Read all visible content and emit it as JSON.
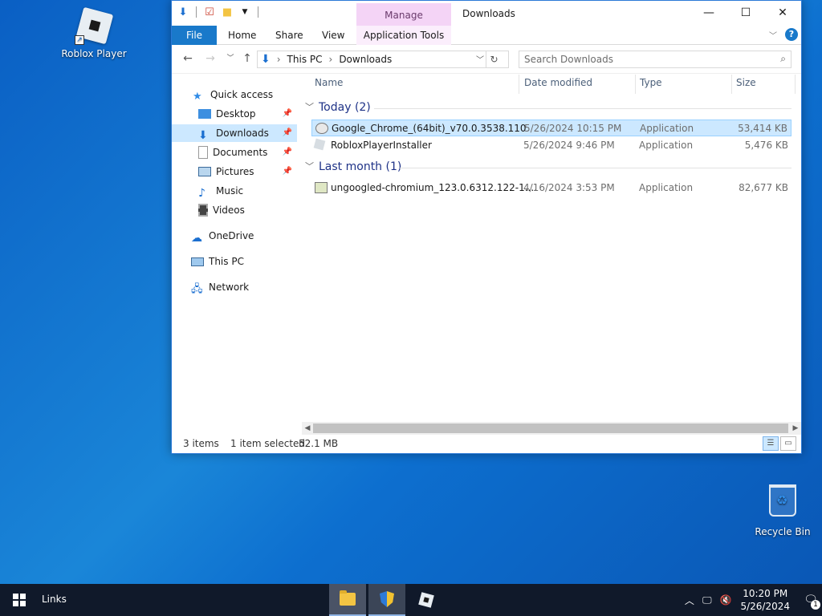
{
  "desktop": {
    "icons": [
      {
        "label": "Roblox Player"
      },
      {
        "label": "Recycle Bin"
      }
    ]
  },
  "window": {
    "title": "Downloads",
    "context_tab_group": "Manage",
    "ribbon_tabs": [
      "File",
      "Home",
      "Share",
      "View",
      "Application Tools"
    ],
    "address": {
      "segments": [
        "This PC",
        "Downloads"
      ]
    },
    "search": {
      "placeholder": "Search Downloads"
    },
    "nav": {
      "items": [
        {
          "label": "Quick access"
        },
        {
          "label": "Desktop"
        },
        {
          "label": "Downloads"
        },
        {
          "label": "Documents"
        },
        {
          "label": "Pictures"
        },
        {
          "label": "Music"
        },
        {
          "label": "Videos"
        },
        {
          "label": "OneDrive"
        },
        {
          "label": "This PC"
        },
        {
          "label": "Network"
        }
      ]
    },
    "columns": [
      "Name",
      "Date modified",
      "Type",
      "Size"
    ],
    "groups": [
      {
        "header": "Today (2)",
        "files": [
          {
            "name": "Google_Chrome_(64bit)_v70.0.3538.110",
            "date": "5/26/2024 10:15 PM",
            "type": "Application",
            "size": "53,414 KB",
            "selected": true
          },
          {
            "name": "RobloxPlayerInstaller",
            "date": "5/26/2024 9:46 PM",
            "type": "Application",
            "size": "5,476 KB",
            "selected": false
          }
        ]
      },
      {
        "header": "Last month (1)",
        "files": [
          {
            "name": "ungoogled-chromium_123.0.6312.122-1....",
            "date": "4/16/2024 3:53 PM",
            "type": "Application",
            "size": "82,677 KB",
            "selected": false
          }
        ]
      }
    ],
    "status": {
      "items": "3 items",
      "selected": "1 item selected",
      "size": "52.1 MB"
    }
  },
  "taskbar": {
    "toolbar_label": "Links",
    "clock": {
      "time": "10:20 PM",
      "date": "5/26/2024"
    },
    "notification_count": "1"
  },
  "colors": {
    "accent": "#1979ca",
    "selection": "#cce8ff",
    "manage_tab": "#f4d4f6",
    "group_header": "#1e3287"
  }
}
